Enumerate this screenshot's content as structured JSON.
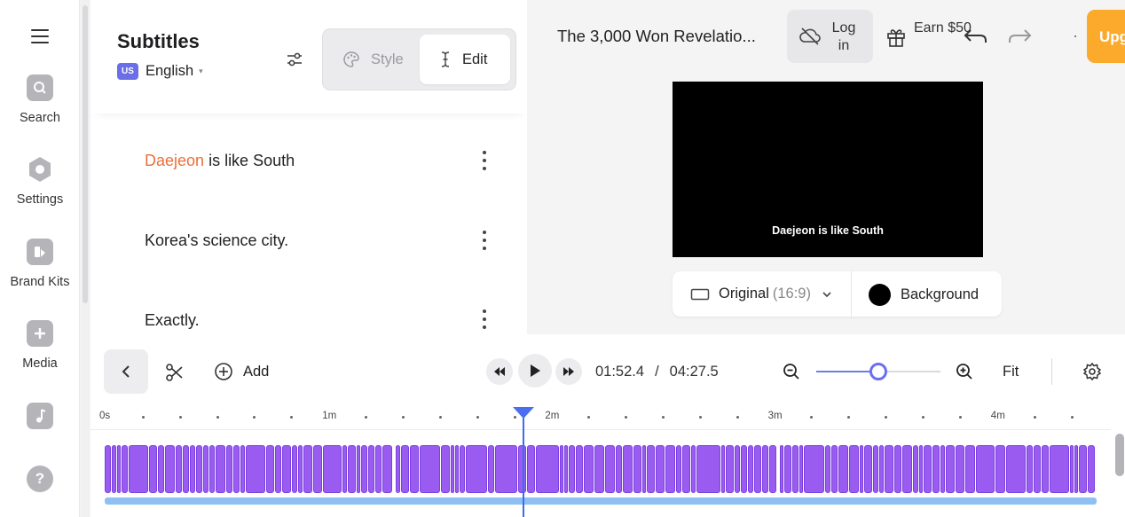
{
  "sidebar": {
    "items": [
      {
        "label": "Search",
        "icon": "search-icon"
      },
      {
        "label": "Settings",
        "icon": "settings-icon"
      },
      {
        "label": "Brand Kits",
        "icon": "brand-kits-icon"
      },
      {
        "label": "Media",
        "icon": "media-plus-icon"
      },
      {
        "label": "",
        "icon": "music-icon"
      },
      {
        "label": "",
        "icon": "help-icon"
      }
    ]
  },
  "subtitles": {
    "title": "Subtitles",
    "language": {
      "flag": "US",
      "name": "English"
    },
    "modes": {
      "style_label": "Style",
      "edit_label": "Edit",
      "active": "Edit"
    },
    "lines": [
      {
        "highlight": "Daejeon",
        "rest": " is like South"
      },
      {
        "highlight": "",
        "rest": "Korea's science city."
      },
      {
        "highlight": "",
        "rest": "Exactly."
      }
    ]
  },
  "topbar": {
    "video_title": "The 3,000 Won Revelatio...",
    "login_label": "Log in",
    "earn_label": "Earn $50",
    "upgrade_label": "Upg"
  },
  "preview": {
    "caption": "Daejeon is like South",
    "aspect_label": "Original",
    "aspect_ratio": "(16:9)",
    "background_label": "Background",
    "background_color": "#000000"
  },
  "timeline": {
    "add_label": "Add",
    "current_time": "01:52.4",
    "time_separator": "/",
    "total_time": "04:27.5",
    "fit_label": "Fit",
    "zoom_level": 0.5,
    "ruler_labels": [
      "0s",
      "1m",
      "2m",
      "3m",
      "4m"
    ],
    "playhead_seconds": 112.4,
    "total_seconds": 267.5
  },
  "colors": {
    "accent": "#6b6ff0",
    "highlight_word": "#e8713b",
    "upgrade": "#fbaa2c",
    "clip": "#9a5cf0"
  }
}
